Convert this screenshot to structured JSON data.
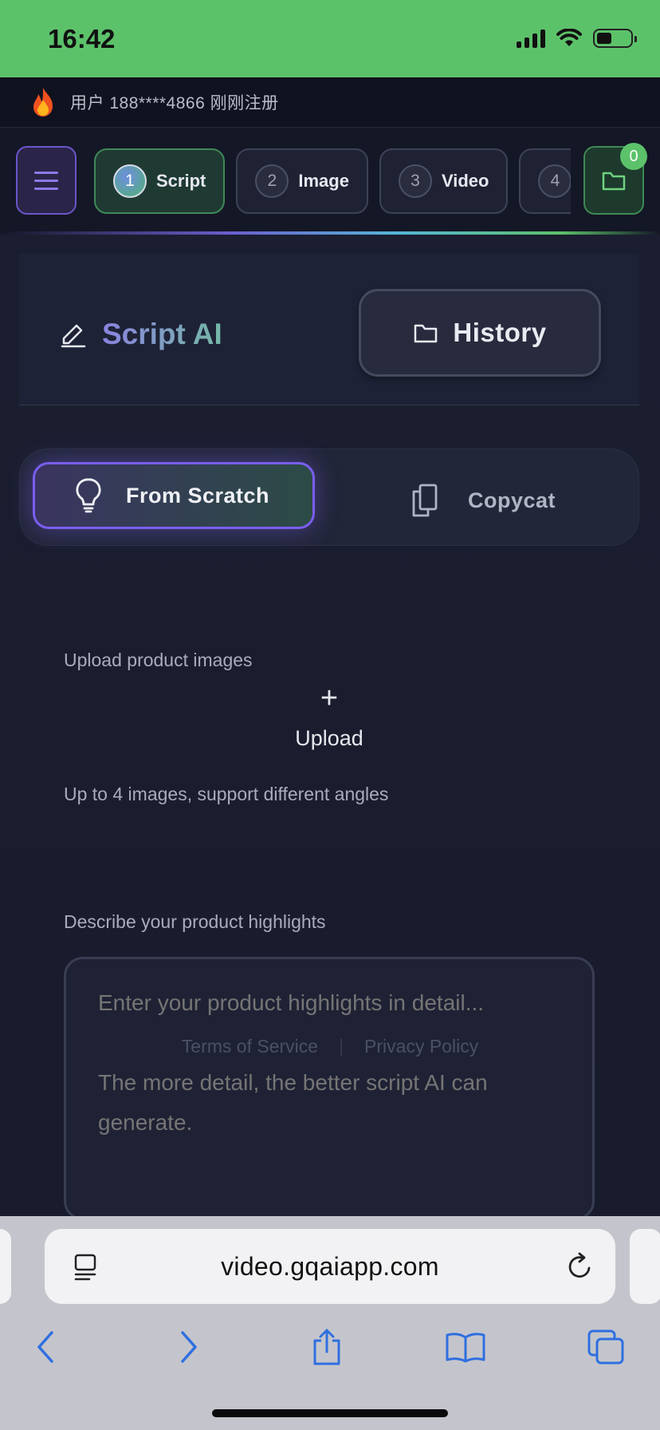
{
  "status_bar": {
    "time": "16:42",
    "battery_percent": 45
  },
  "notice": {
    "text": "用户 188****4866 刚刚注册"
  },
  "steps": [
    {
      "num": "1",
      "label": "Script",
      "active": true
    },
    {
      "num": "2",
      "label": "Image",
      "active": false
    },
    {
      "num": "3",
      "label": "Video",
      "active": false
    },
    {
      "num": "4",
      "label": "",
      "active": false
    }
  ],
  "folder": {
    "badge_count": "0"
  },
  "header": {
    "title": "Script AI",
    "history_label": "History"
  },
  "modes": {
    "from_scratch": "From Scratch",
    "copycat": "Copycat",
    "selected": "From Scratch"
  },
  "upload": {
    "section_label": "Upload product images",
    "plus": "+",
    "button_label": "Upload",
    "hint": "Up to 4 images, support different angles"
  },
  "highlights": {
    "section_label": "Describe your product highlights",
    "placeholder": "Enter your product highlights in detail...\n\nThe more detail, the better script AI can generate."
  },
  "footer": {
    "terms": "Terms of Service",
    "separator": "|",
    "privacy": "Privacy Policy"
  },
  "browser": {
    "url": "video.gqaiapp.com"
  },
  "colors": {
    "status_bar": "#5cc26a",
    "accent_purple": "#7a5ef0",
    "accent_green": "#5cc26a",
    "background": "#181b2b"
  },
  "icons": {
    "menu": "hamburger-icon",
    "folder": "folder-icon",
    "edit": "pencil-icon",
    "history": "folder-icon",
    "scratch": "lightbulb-icon",
    "copycat": "copy-icon"
  }
}
